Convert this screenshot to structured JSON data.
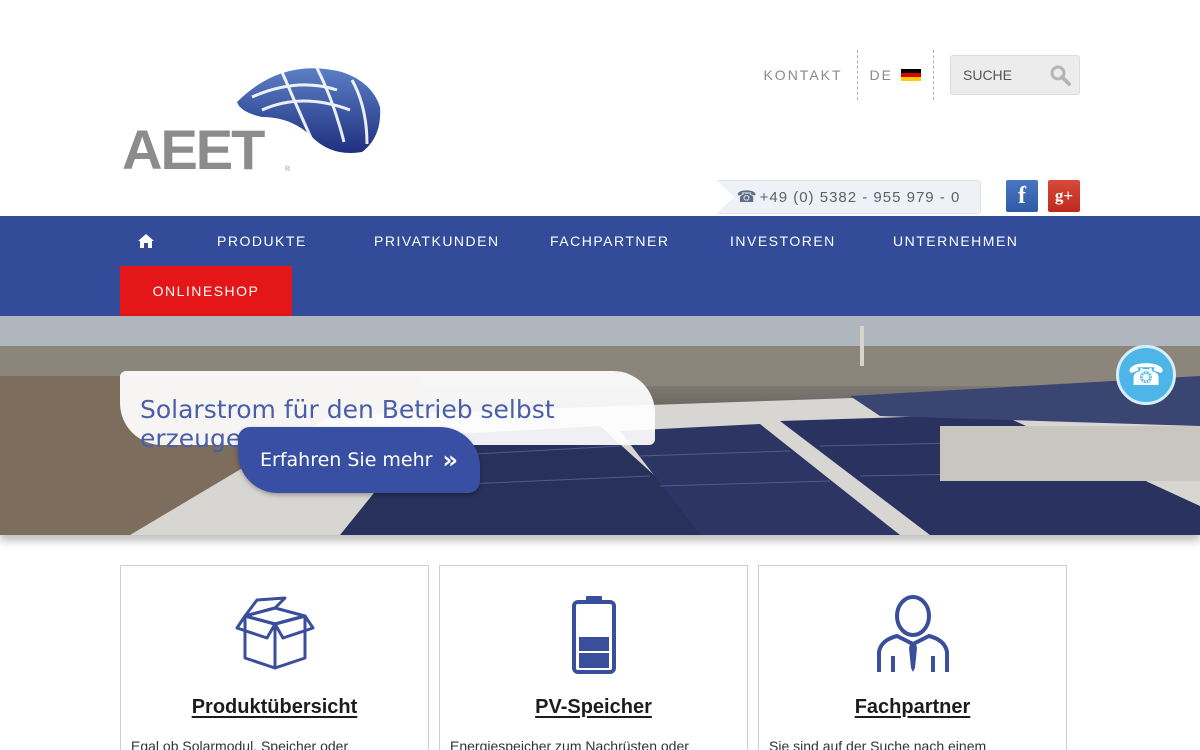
{
  "header": {
    "logo_text": "AEET",
    "kontakt_label": "KONTAKT",
    "language_label": "DE",
    "search_placeholder": "SUCHE",
    "phone": "+49 (0) 5382 - 955 979 - 0"
  },
  "social": {
    "facebook_label": "f",
    "googleplus_label": "g+"
  },
  "nav": {
    "items": [
      {
        "label": "PRODUKTE"
      },
      {
        "label": "PRIVATKUNDEN"
      },
      {
        "label": "FACHPARTNER"
      },
      {
        "label": "INVESTOREN"
      },
      {
        "label": "UNTERNEHMEN"
      }
    ],
    "onlineshop_label": "ONLINESHOP"
  },
  "hero": {
    "headline": "Solarstrom für den Betrieb selbst erzeugen",
    "cta_label": "Erfahren Sie mehr",
    "cta_chevron": "»"
  },
  "cards": [
    {
      "title": "Produktübersicht",
      "teaser": "Egal ob Solarmodul, Speicher oder"
    },
    {
      "title": "PV-Speicher",
      "teaser": "Energiespeicher zum Nachrüsten oder"
    },
    {
      "title": "Fachpartner",
      "teaser": "Sie sind auf der Suche nach einem"
    }
  ],
  "colors": {
    "nav_blue": "#334c9a",
    "onlineshop_red": "#e41617",
    "icon_blue": "#3a4f9c",
    "call_bubble": "#4db5e8"
  },
  "icons": {
    "home": "home-icon",
    "search": "search-icon",
    "phone": "phone-icon",
    "call": "call-bubble-icon",
    "card_1": "box-icon",
    "card_2": "battery-icon",
    "card_3": "businessman-icon"
  }
}
